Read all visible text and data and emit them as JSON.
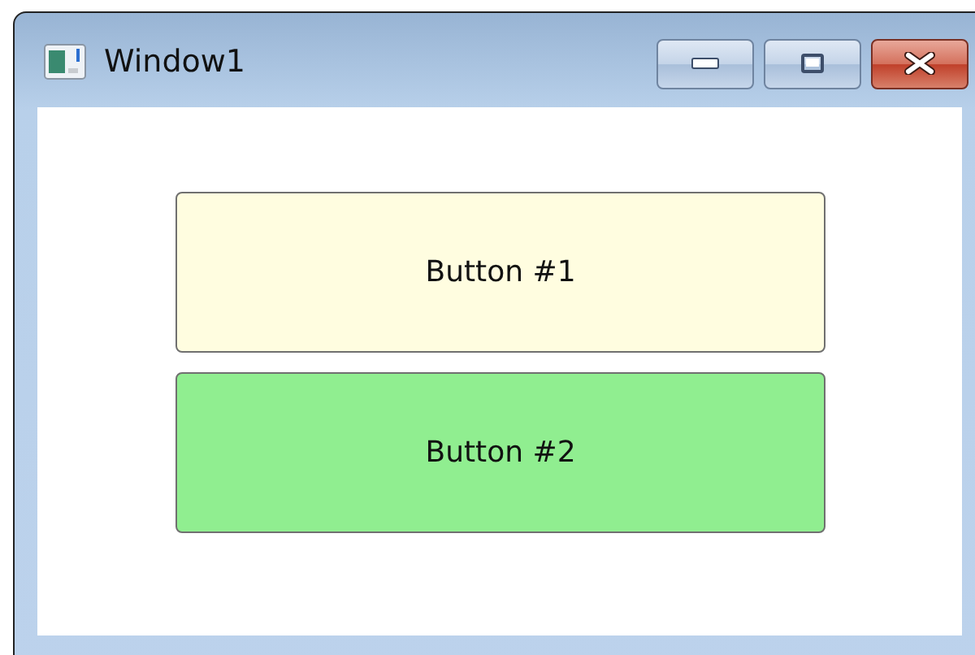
{
  "window": {
    "title": "Window1"
  },
  "buttons": [
    {
      "label": "Button #1",
      "color": "#fffde0"
    },
    {
      "label": "Button #2",
      "color": "#90ee90"
    }
  ]
}
